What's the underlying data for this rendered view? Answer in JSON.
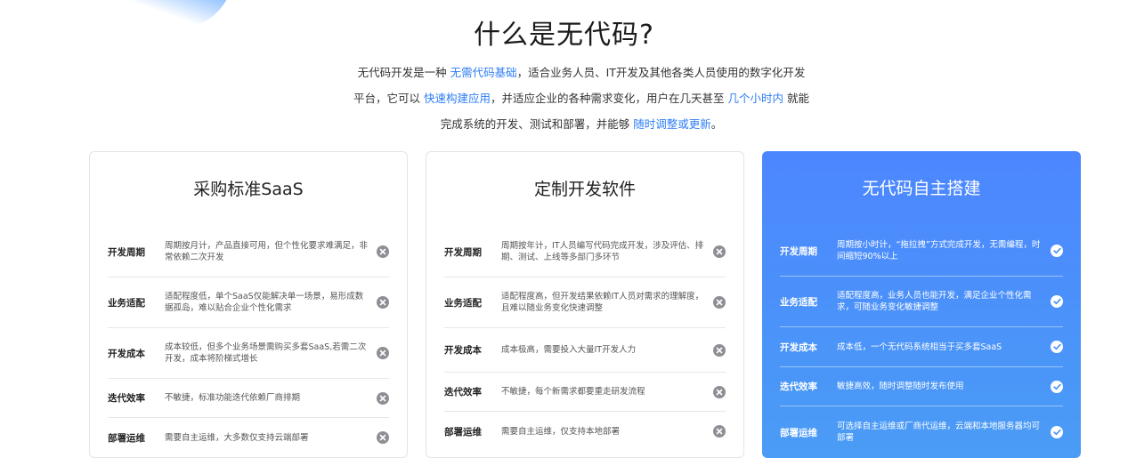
{
  "title": "什么是无代码?",
  "intro": {
    "line1": [
      {
        "text": "无代码开发是一种 ",
        "hl": false
      },
      {
        "text": "无需代码基础",
        "hl": true
      },
      {
        "text": "，适合业务人员、IT开发及其他各类人员使用的数字化开发",
        "hl": false
      }
    ],
    "line2": [
      {
        "text": "平台，它可以 ",
        "hl": false
      },
      {
        "text": "快速构建应用",
        "hl": true
      },
      {
        "text": "，并适应企业的各种需求变化，用户在几天甚至 ",
        "hl": false
      },
      {
        "text": "几个小时内",
        "hl": true
      },
      {
        "text": " 就能",
        "hl": false
      }
    ],
    "line3": [
      {
        "text": "完成系统的开发、测试和部署，并能够 ",
        "hl": false
      },
      {
        "text": "随时调整或更新",
        "hl": true
      },
      {
        "text": "。",
        "hl": false
      }
    ]
  },
  "cards": [
    {
      "title": "采购标准SaaS",
      "status_icon": "close-circle-icon",
      "rows": [
        {
          "label": "开发周期",
          "desc": "周期按月计，产品直接可用，但个性化要求难满足，非常依赖二次开发"
        },
        {
          "label": "业务适配",
          "desc": "适配程度低，单个SaaS仅能解决单一场景，易形成数据孤岛，难以贴合企业个性化需求"
        },
        {
          "label": "开发成本",
          "desc": "成本较低，但多个业务场景需购买多套SaaS,若需二次开发，成本将阶梯式增长"
        },
        {
          "label": "迭代效率",
          "desc": "不敏捷，标准功能迭代依赖厂商排期"
        },
        {
          "label": "部署运维",
          "desc": "需要自主运维，大多数仅支持云端部署"
        }
      ]
    },
    {
      "title": "定制开发软件",
      "status_icon": "close-circle-icon",
      "rows": [
        {
          "label": "开发周期",
          "desc": "周期按年计，IT人员编写代码完成开发，涉及评估、排期、测试、上线等多部门多环节"
        },
        {
          "label": "业务适配",
          "desc": "适配程度高，但开发结果依赖IT人员对需求的理解度，且难以随业务变化快速调整"
        },
        {
          "label": "开发成本",
          "desc": "成本极高，需要投入大量IT开发人力"
        },
        {
          "label": "迭代效率",
          "desc": "不敏捷，每个新需求都要重走研发流程"
        },
        {
          "label": "部署运维",
          "desc": "需要自主运维，仅支持本地部署"
        }
      ]
    },
    {
      "title": "无代码自主搭建",
      "status_icon": "check-circle-icon",
      "rows": [
        {
          "label": "开发周期",
          "desc": "周期按小时计，“拖拉拽”方式完成开发，无需编程，时间缩短90%以上"
        },
        {
          "label": "业务适配",
          "desc": "适配程度高，业务人员也能开发，满足企业个性化需求，可随业务变化敏捷调整"
        },
        {
          "label": "开发成本",
          "desc": "成本低，一个无代码系统相当于买多套SaaS"
        },
        {
          "label": "迭代效率",
          "desc": "敏捷高效，随时调整随时发布使用"
        },
        {
          "label": "部署运维",
          "desc": "可选择自主运维或厂商代运维，云端和本地服务器均可部署"
        }
      ]
    }
  ],
  "colors": {
    "accent": "#2d7df5",
    "card_gradient_top": "#4c86ff",
    "card_gradient_bottom": "#4a9cf5",
    "x_icon": "#8d8f94"
  }
}
